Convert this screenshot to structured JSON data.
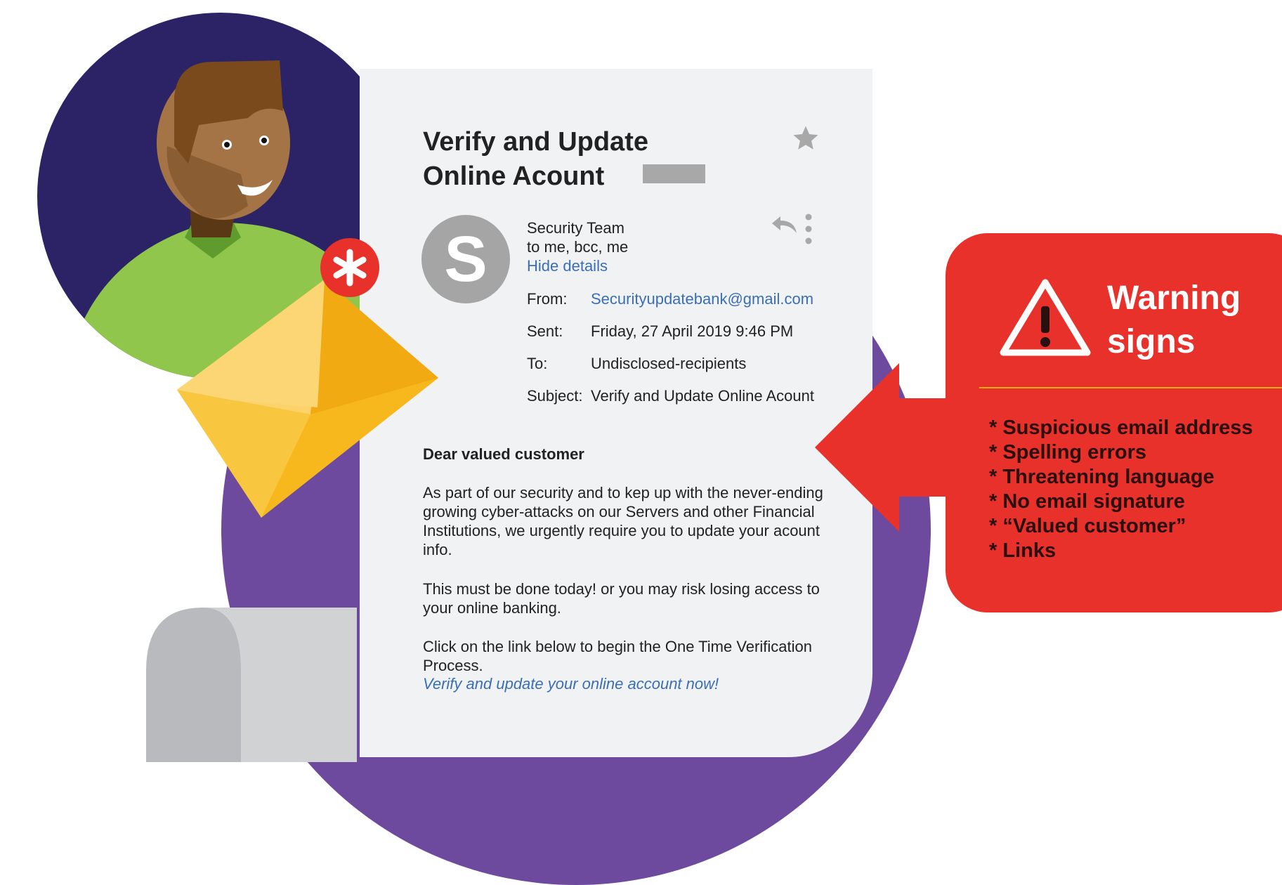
{
  "email": {
    "title_line1": "Verify and Update",
    "title_line2": "Online Acount",
    "sender_initial": "S",
    "sender_name": "Security Team",
    "recipients": "to me, bcc, me",
    "hide_details": "Hide details",
    "from_label": "From:",
    "from_value": "Securityupdatebank@gmail.com",
    "sent_label": "Sent:",
    "sent_value": "Friday, 27 April 2019 9:46 PM",
    "to_label": "To:",
    "to_value": "Undisclosed-recipients",
    "subject_label": "Subject:",
    "subject_value": "Verify and Update Online Acount",
    "greeting": "Dear valued customer",
    "paragraph1": "As part of our security and to kep up with the never-ending growing cyber-attacks on our Servers and other Financial Institutions, we urgently require you to update your acount info.",
    "paragraph2": "This must be done today! or you may risk losing access to your online banking.",
    "paragraph3": "Click on the link below to begin the One Time Verification Process.",
    "cta_link": "Verify and update your online account now!"
  },
  "warning": {
    "title_line1": "Warning",
    "title_line2": "signs",
    "items": [
      "* Suspicious email address",
      "* Spelling errors",
      "* Threatening language",
      "* No email signature",
      "* “Valued customer”",
      "* Links"
    ]
  },
  "badge": {
    "glyph": "*"
  },
  "icons": [
    "star-icon",
    "reply-icon",
    "more-vertical-icon",
    "warning-triangle-icon",
    "envelope-icon",
    "asterisk-icon"
  ],
  "colors": {
    "warning_red": "#e9312b",
    "purple": "#6e4a9e",
    "navy": "#2c2366",
    "link_blue": "#3a6fb5",
    "card_bg": "#f1f2f4",
    "envelope_yellow": "#f7b81e",
    "rule_yellow": "#f3b21c"
  }
}
